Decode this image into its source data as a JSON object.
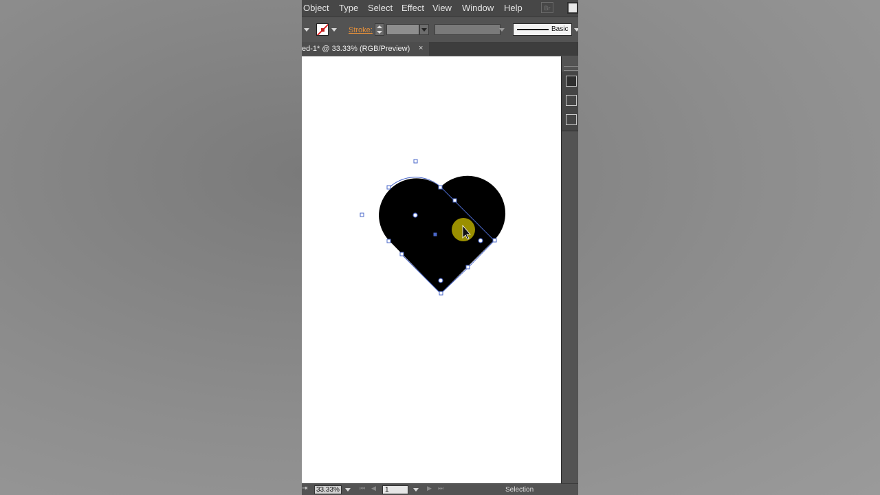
{
  "menu": {
    "items": [
      {
        "label": "Object"
      },
      {
        "label": "Type"
      },
      {
        "label": "Select"
      },
      {
        "label": "Effect"
      },
      {
        "label": "View"
      },
      {
        "label": "Window"
      },
      {
        "label": "Help"
      }
    ],
    "bridge_label": "Br"
  },
  "control_bar": {
    "stroke_label": "Stroke:",
    "brush_label": "Basic"
  },
  "document": {
    "tab_title": "ed-1* @ 33.33% (RGB/Preview)",
    "close_glyph": "×"
  },
  "status_bar": {
    "zoom": "33.33%",
    "page": "1",
    "status": "Selection"
  },
  "colors": {
    "shape_fill": "#000000",
    "selection": "#4a67c9",
    "cursor_highlight": "#b5a800"
  },
  "icons": [
    "fill-none-swatch-icon",
    "stepper-icon",
    "chevron-down-icon",
    "close-icon",
    "arrange-icon",
    "align-icon",
    "pathfinder-icon",
    "cursor-arrow-icon",
    "first-page-icon",
    "prev-page-icon",
    "next-page-icon",
    "last-page-icon"
  ]
}
